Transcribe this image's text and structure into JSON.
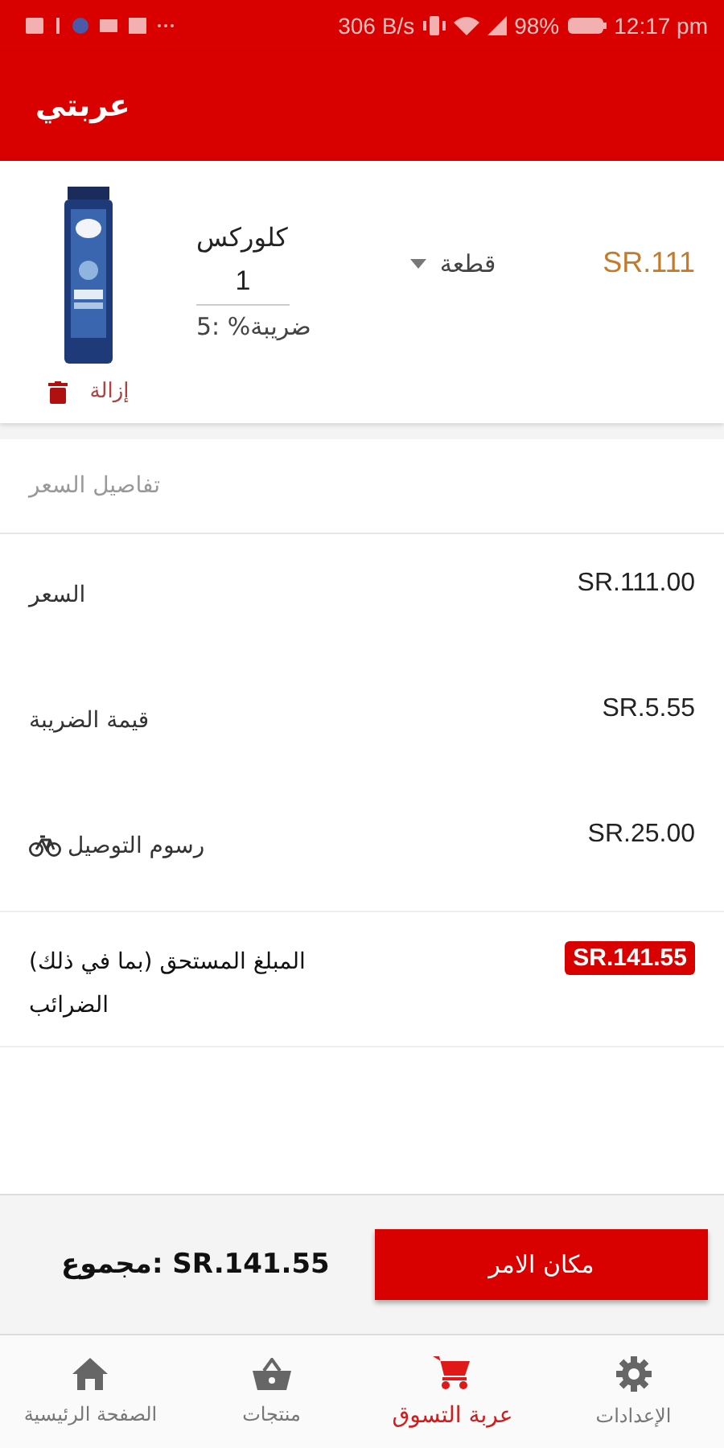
{
  "status_bar": {
    "speed": "306 B/s",
    "battery": "98%",
    "time": "12:17 pm"
  },
  "app_bar": {
    "title": "عربتي"
  },
  "cart_item": {
    "name": "كلوركس",
    "quantity": "1",
    "unit": "قطعة",
    "price": "SR.111",
    "tax": "5: %ضريبة",
    "remove": "إزالة"
  },
  "price_details": {
    "heading": "تفاصيل السعر",
    "rows": [
      {
        "kind": "plain",
        "label": "السعر",
        "value": "SR.111.00"
      },
      {
        "kind": "plain",
        "label": "قيمة الضريبة",
        "value": "SR.5.55"
      },
      {
        "kind": "delivery",
        "label": "رسوم التوصيل",
        "value": "SR.25.00"
      },
      {
        "kind": "total",
        "label": "المبلغ المستحق (بما في ذلك) الضرائب",
        "value": "SR.141.55"
      }
    ]
  },
  "footer": {
    "total": "مجموع: SR.141.55",
    "button": "مكان الامر"
  },
  "bottom_nav": [
    {
      "label": "الإعدادات",
      "kind": "settings",
      "selected": false
    },
    {
      "label": "عربة التسوق",
      "kind": "cart",
      "selected": true
    },
    {
      "label": "منتجات",
      "kind": "products",
      "selected": false
    },
    {
      "label": "الصفحة الرئيسية",
      "kind": "home",
      "selected": false
    }
  ]
}
